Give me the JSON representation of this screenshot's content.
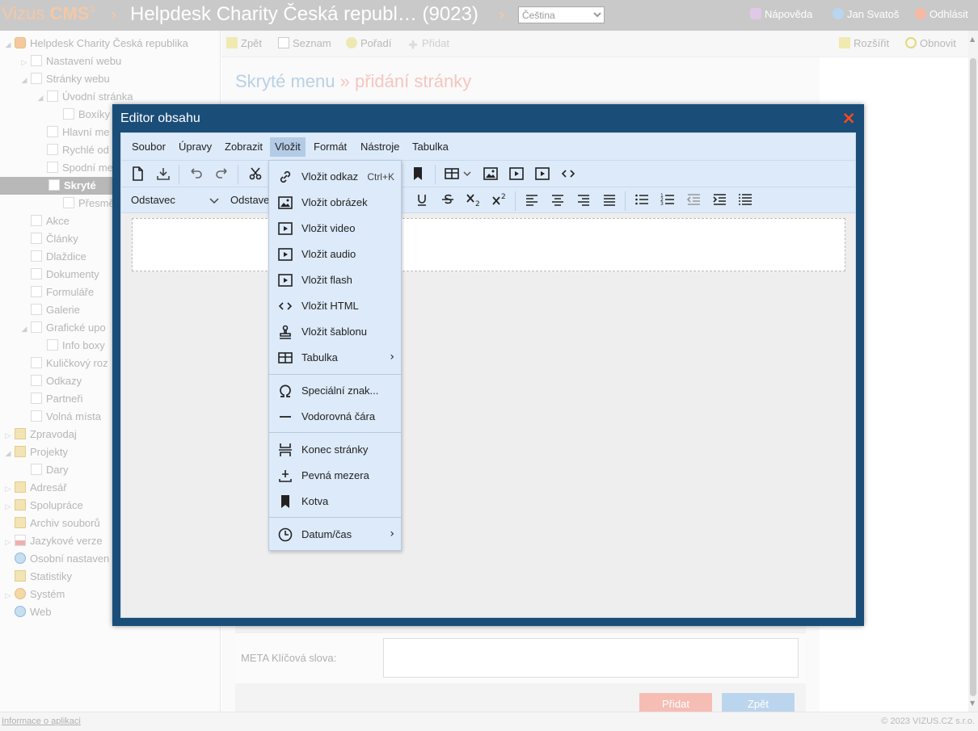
{
  "topbar": {
    "brand_name": "Vizus",
    "brand_cms": "CMS",
    "brand_version": "3",
    "site_title": "Helpdesk Charity Česká republ… (9023)",
    "language_selected": "Čeština",
    "help_label": "Nápověda",
    "user_label": "Jan Svatoš",
    "logout_label": "Odhlásit"
  },
  "sidebar": {
    "items": [
      {
        "label": "Helpdesk Charity Česká republika"
      },
      {
        "label": "Nastavení webu"
      },
      {
        "label": "Stránky webu"
      },
      {
        "label": "Úvodní stránka"
      },
      {
        "label": "Boxíky"
      },
      {
        "label": "Hlavní me"
      },
      {
        "label": "Rychlé od"
      },
      {
        "label": "Spodní me"
      },
      {
        "label": "Skryté"
      },
      {
        "label": "Přesměro"
      },
      {
        "label": "Akce"
      },
      {
        "label": "Články"
      },
      {
        "label": "Dlaždice"
      },
      {
        "label": "Dokumenty"
      },
      {
        "label": "Formuláře"
      },
      {
        "label": "Galerie"
      },
      {
        "label": "Grafické upo"
      },
      {
        "label": "Info boxy"
      },
      {
        "label": "Kuličkový roz"
      },
      {
        "label": "Odkazy"
      },
      {
        "label": "Partneři"
      },
      {
        "label": "Volná místa"
      },
      {
        "label": "Zpravodaj"
      },
      {
        "label": "Projekty"
      },
      {
        "label": "Dary"
      },
      {
        "label": "Adresář"
      },
      {
        "label": "Spolupráce"
      },
      {
        "label": "Archiv souborů"
      },
      {
        "label": "Jazykové verze"
      },
      {
        "label": "Osobní nastaven"
      },
      {
        "label": "Statistiky"
      },
      {
        "label": "Systém"
      },
      {
        "label": "Web"
      }
    ]
  },
  "content_toolbar": {
    "back_label": "Zpět",
    "list_label": "Seznam",
    "order_label": "Pořadí",
    "add_label": "Přidat",
    "expand_label": "Rozšířit",
    "refresh_label": "Obnovit"
  },
  "page": {
    "heading_part1": "Skryté menu",
    "heading_sep": " » ",
    "heading_part2": "přidání stránky",
    "meta_keywords_label": "META Klíčová slova:",
    "add_button": "Přidat",
    "back_button": "Zpět"
  },
  "modal": {
    "title": "Editor obsahu",
    "close_icon": "×"
  },
  "editor": {
    "menubar": [
      "Soubor",
      "Úpravy",
      "Zobrazit",
      "Vložit",
      "Formát",
      "Nástroje",
      "Tabulka"
    ],
    "active_menu": "Vložit",
    "block_format": "Odstavec",
    "paragraph_style": "Odstave"
  },
  "dropdown": {
    "items": [
      {
        "label": "Vložit odkaz",
        "shortcut": "Ctrl+K",
        "icon": "link-icon"
      },
      {
        "label": "Vložit obrázek",
        "icon": "image-icon"
      },
      {
        "label": "Vložit video",
        "icon": "video-icon"
      },
      {
        "label": "Vložit audio",
        "icon": "audio-icon"
      },
      {
        "label": "Vložit flash",
        "icon": "flash-icon"
      },
      {
        "label": "Vložit HTML",
        "icon": "code-icon"
      },
      {
        "label": "Vložit šablonu",
        "icon": "template-icon"
      },
      {
        "label": "Tabulka",
        "icon": "table-icon",
        "submenu": true
      },
      {
        "label": "Speciální znak...",
        "icon": "omega-icon"
      },
      {
        "label": "Vodorovná čára",
        "icon": "hr-icon"
      },
      {
        "label": "Konec stránky",
        "icon": "pagebreak-icon"
      },
      {
        "label": "Pevná mezera",
        "icon": "nbsp-icon"
      },
      {
        "label": "Kotva",
        "icon": "bookmark-icon"
      },
      {
        "label": "Datum/čas",
        "icon": "clock-icon",
        "submenu": true
      }
    ],
    "submenu_arrow": "›"
  },
  "footer": {
    "info_link": "Informace o aplikaci",
    "copyright": "© 2023 VIZUS.CZ s.r.o."
  },
  "colors": {
    "modal_header": "#1b4d79",
    "editor_bar": "#ddeafa",
    "close": "#ff4a1c",
    "heading_blue": "#b9d0e6",
    "heading_red": "#f5c6c0"
  }
}
